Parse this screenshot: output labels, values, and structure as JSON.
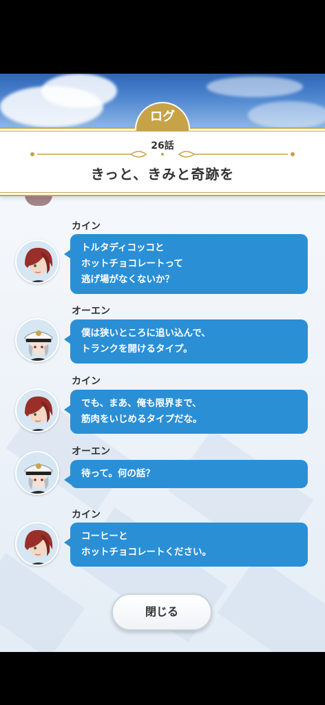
{
  "header": {
    "tab_label": "ログ",
    "episode": "26話",
    "story_title": "きっと、きみと奇跡を"
  },
  "messages": [
    {
      "speaker": "カイン",
      "character": "red-hair",
      "lines": [
        "トルタディコッコと",
        "ホットチョコレートって",
        "逃げ場がなくないか？"
      ]
    },
    {
      "speaker": "オーエン",
      "character": "white-cap",
      "lines": [
        "僕は狭いところに追い込んで、",
        "トランクを開けるタイプ。"
      ]
    },
    {
      "speaker": "カイン",
      "character": "red-hair",
      "lines": [
        "でも、まあ、俺も限界まで、",
        "筋肉をいじめるタイプだな。"
      ]
    },
    {
      "speaker": "オーエン",
      "character": "white-cap",
      "lines": [
        "待って。何の話？"
      ]
    },
    {
      "speaker": "カイン",
      "character": "red-hair",
      "lines": [
        "コーヒーと",
        "ホットチョコレートください。"
      ]
    }
  ],
  "footer": {
    "close_label": "閉じる"
  },
  "colors": {
    "bubble": "#2b8fd6",
    "gold": "#c7a348",
    "sky": "#4f86cf"
  }
}
